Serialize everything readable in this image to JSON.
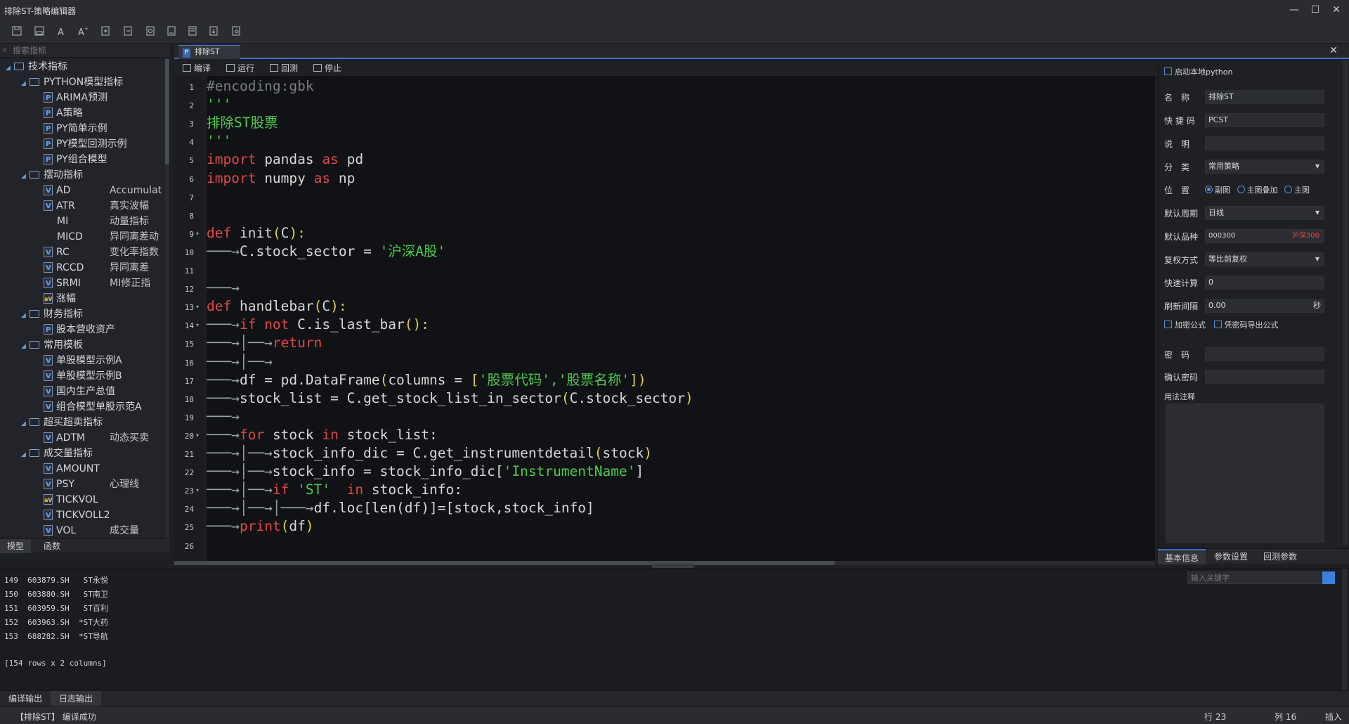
{
  "window": {
    "title": "排除ST-策略编辑器",
    "minimize": "—",
    "maximize": "☐",
    "close": "✕"
  },
  "left": {
    "search_placeholder": "搜索指标",
    "tree": [
      {
        "label": "技术指标",
        "level": 0,
        "type": "folder"
      },
      {
        "label": "PYTHON模型指标",
        "level": 1,
        "type": "folder"
      },
      {
        "label": "ARIMA预测",
        "level": 2,
        "type": "py"
      },
      {
        "label": "A策略",
        "level": 2,
        "type": "py"
      },
      {
        "label": "PY简单示例",
        "level": 2,
        "type": "py"
      },
      {
        "label": "PY模型回测示例",
        "level": 2,
        "type": "py"
      },
      {
        "label": "PY组合模型",
        "level": 2,
        "type": "py"
      },
      {
        "label": "摆动指标",
        "level": 1,
        "type": "folder"
      },
      {
        "label": "AD",
        "level": 2,
        "type": "v",
        "desc": "Accumulat"
      },
      {
        "label": "ATR",
        "level": 2,
        "type": "v",
        "desc": "真实波幅"
      },
      {
        "label": "MI",
        "level": 2,
        "type": "none",
        "desc": "动量指标"
      },
      {
        "label": "MICD",
        "level": 2,
        "type": "none",
        "desc": "异同离差动"
      },
      {
        "label": "RC",
        "level": 2,
        "type": "v",
        "desc": "变化率指数"
      },
      {
        "label": "RCCD",
        "level": 2,
        "type": "v",
        "desc": "异同离差"
      },
      {
        "label": "SRMI",
        "level": 2,
        "type": "v",
        "desc": "MI修正指"
      },
      {
        "label": "涨幅",
        "level": 2,
        "type": "av"
      },
      {
        "label": "财务指标",
        "level": 1,
        "type": "folder"
      },
      {
        "label": "股本营收资产",
        "level": 2,
        "type": "py"
      },
      {
        "label": "常用模板",
        "level": 1,
        "type": "folder"
      },
      {
        "label": "单股模型示例A",
        "level": 2,
        "type": "v"
      },
      {
        "label": "单股模型示例B",
        "level": 2,
        "type": "v"
      },
      {
        "label": "国内生产总值",
        "level": 2,
        "type": "v"
      },
      {
        "label": "组合模型单股示范A",
        "level": 2,
        "type": "v"
      },
      {
        "label": "超买超卖指标",
        "level": 1,
        "type": "folder"
      },
      {
        "label": "ADTM",
        "level": 2,
        "type": "v",
        "desc": "动态买卖"
      },
      {
        "label": "成交量指标",
        "level": 1,
        "type": "folder"
      },
      {
        "label": "AMOUNT",
        "level": 2,
        "type": "v"
      },
      {
        "label": "PSY",
        "level": 2,
        "type": "v",
        "desc": "心理线"
      },
      {
        "label": "TICKVOL",
        "level": 2,
        "type": "av"
      },
      {
        "label": "TICKVOLL2",
        "level": 2,
        "type": "v"
      },
      {
        "label": "VOL",
        "level": 2,
        "type": "v",
        "desc": "成交量"
      }
    ],
    "tabs": [
      "模型",
      "函数"
    ]
  },
  "editor": {
    "tab_label": "排除ST",
    "tab_icon": "P",
    "toolbar": {
      "compile": "编译",
      "run": "运行",
      "backtest": "回测",
      "stop": "停止"
    },
    "code_lines": [
      {
        "n": "1",
        "fold": "",
        "segs": [
          [
            "c",
            "#encoding:gbk"
          ]
        ]
      },
      {
        "n": "2",
        "fold": "",
        "segs": [
          [
            "s",
            "'''"
          ]
        ]
      },
      {
        "n": "3",
        "fold": "",
        "segs": [
          [
            "s",
            "排除ST股票"
          ]
        ]
      },
      {
        "n": "4",
        "fold": "",
        "segs": [
          [
            "s",
            "'''"
          ]
        ]
      },
      {
        "n": "5",
        "fold": "",
        "segs": [
          [
            "k",
            "import"
          ],
          [
            "n",
            " pandas "
          ],
          [
            "k",
            "as"
          ],
          [
            "n",
            " pd"
          ]
        ]
      },
      {
        "n": "6",
        "fold": "",
        "segs": [
          [
            "k",
            "import"
          ],
          [
            "n",
            " numpy "
          ],
          [
            "k",
            "as"
          ],
          [
            "n",
            " np"
          ]
        ]
      },
      {
        "n": "7",
        "fold": "",
        "segs": []
      },
      {
        "n": "8",
        "fold": "",
        "segs": []
      },
      {
        "n": "9",
        "fold": "▾",
        "segs": [
          [
            "k",
            "def"
          ],
          [
            "n",
            " init"
          ],
          [
            "d",
            "("
          ],
          [
            "n",
            "C"
          ],
          [
            "d",
            "):"
          ]
        ]
      },
      {
        "n": "10",
        "fold": "",
        "segs": [
          [
            "ar",
            "───→"
          ],
          [
            "n",
            "C.stock_sector = "
          ],
          [
            "s",
            "'沪深A股'"
          ]
        ]
      },
      {
        "n": "11",
        "fold": "",
        "segs": []
      },
      {
        "n": "12",
        "fold": "",
        "segs": [
          [
            "ar",
            "───→"
          ]
        ]
      },
      {
        "n": "13",
        "fold": "▾",
        "segs": [
          [
            "k",
            "def"
          ],
          [
            "n",
            " handlebar"
          ],
          [
            "d",
            "("
          ],
          [
            "n",
            "C"
          ],
          [
            "d",
            "):"
          ]
        ]
      },
      {
        "n": "14",
        "fold": "▾",
        "segs": [
          [
            "ar",
            "───→"
          ],
          [
            "k",
            "if not"
          ],
          [
            "n",
            " C.is_last_bar"
          ],
          [
            "d",
            "():"
          ]
        ]
      },
      {
        "n": "15",
        "fold": "",
        "segs": [
          [
            "ar",
            "───→│──→"
          ],
          [
            "k",
            "return"
          ]
        ]
      },
      {
        "n": "16",
        "fold": "",
        "segs": [
          [
            "ar",
            "───→│──→"
          ]
        ]
      },
      {
        "n": "17",
        "fold": "",
        "segs": [
          [
            "ar",
            "───→"
          ],
          [
            "n",
            "df = pd.DataFrame"
          ],
          [
            "d",
            "("
          ],
          [
            "n",
            "columns = "
          ],
          [
            "d",
            "["
          ],
          [
            "s",
            "'股票代码','股票名称'"
          ],
          [
            "d",
            "])"
          ]
        ]
      },
      {
        "n": "18",
        "fold": "",
        "segs": [
          [
            "ar",
            "───→"
          ],
          [
            "n",
            "stock_list = C.get_stock_list_in_sector"
          ],
          [
            "d",
            "("
          ],
          [
            "n",
            "C.stock_sector"
          ],
          [
            "d",
            ")"
          ]
        ]
      },
      {
        "n": "19",
        "fold": "",
        "segs": [
          [
            "ar",
            "───→"
          ]
        ]
      },
      {
        "n": "20",
        "fold": "▾",
        "segs": [
          [
            "ar",
            "───→"
          ],
          [
            "k",
            "for"
          ],
          [
            "n",
            " stock "
          ],
          [
            "k",
            "in"
          ],
          [
            "n",
            " stock_list:"
          ]
        ]
      },
      {
        "n": "21",
        "fold": "",
        "segs": [
          [
            "ar",
            "───→│──→"
          ],
          [
            "n",
            "stock_info_dic = C.get_instrumentdetail"
          ],
          [
            "d",
            "("
          ],
          [
            "n",
            "stock"
          ],
          [
            "d",
            ")"
          ]
        ]
      },
      {
        "n": "22",
        "fold": "",
        "segs": [
          [
            "ar",
            "───→│──→"
          ],
          [
            "n",
            "stock_info = stock_info_dic["
          ],
          [
            "s",
            "'InstrumentName'"
          ],
          [
            "n",
            "]"
          ]
        ]
      },
      {
        "n": "23",
        "fold": "▾",
        "segs": [
          [
            "ar",
            "───→│──→"
          ],
          [
            "k",
            "if"
          ],
          [
            "n",
            " "
          ],
          [
            "s",
            "'ST'"
          ],
          [
            "n",
            "  "
          ],
          [
            "k",
            "in"
          ],
          [
            "n",
            " stock_info:"
          ]
        ]
      },
      {
        "n": "24",
        "fold": "",
        "segs": [
          [
            "ar",
            "───→│──→│───→"
          ],
          [
            "n",
            "df.loc[len(df)]=[stock,stock_info]"
          ]
        ]
      },
      {
        "n": "25",
        "fold": "",
        "segs": [
          [
            "ar",
            "───→"
          ],
          [
            "k",
            "print"
          ],
          [
            "d",
            "("
          ],
          [
            "n",
            "df"
          ],
          [
            "d",
            ")"
          ]
        ]
      },
      {
        "n": "26",
        "fold": "",
        "segs": []
      }
    ]
  },
  "props": {
    "local_python": "启动本地python",
    "name_label": "名　称",
    "name_value": "排除ST",
    "shortcut_label": "快 捷 码",
    "shortcut_value": "PCST",
    "desc_label": "说　明",
    "desc_value": "",
    "category_label": "分　类",
    "category_value": "常用策略",
    "position_label": "位　置",
    "pos_sub": "副图",
    "pos_overlay": "主图叠加",
    "pos_main": "主图",
    "period_label": "默认周期",
    "period_value": "日线",
    "symbol_label": "默认品种",
    "symbol_code": "000300",
    "symbol_name": "沪深300",
    "adjust_label": "复权方式",
    "adjust_value": "等比前复权",
    "fastcalc_label": "快速计算",
    "fastcalc_value": "0",
    "refresh_label": "刷新间隔",
    "refresh_value": "0.00",
    "refresh_unit": "秒",
    "encrypt_label": "加密公式",
    "export_label": "凭密码导出公式",
    "password_label": "密　码",
    "confirm_label": "确认密码",
    "notes_label": "用法注释",
    "tabs": [
      "基本信息",
      "参数设置",
      "回测参数"
    ],
    "symbol_color": "#e04848"
  },
  "output": {
    "search_placeholder": "输入关键字",
    "rows": [
      "149  603879.SH   ST永悦",
      "150  603880.SH   ST南卫",
      "151  603959.SH   ST百利",
      "152  603963.SH  *ST大药",
      "153  688282.SH  *ST导航",
      "",
      "[154 rows x 2 columns]"
    ],
    "tabs": [
      "编译输出",
      "日志输出"
    ]
  },
  "status": {
    "message": "【排除ST】 编译成功",
    "row": "行 23",
    "col": "列 16",
    "mode": "插入"
  },
  "colors": {
    "accent": "#3b73d1",
    "keyword": "#e04848",
    "string": "#4ccb4c",
    "bg": "#111215"
  }
}
